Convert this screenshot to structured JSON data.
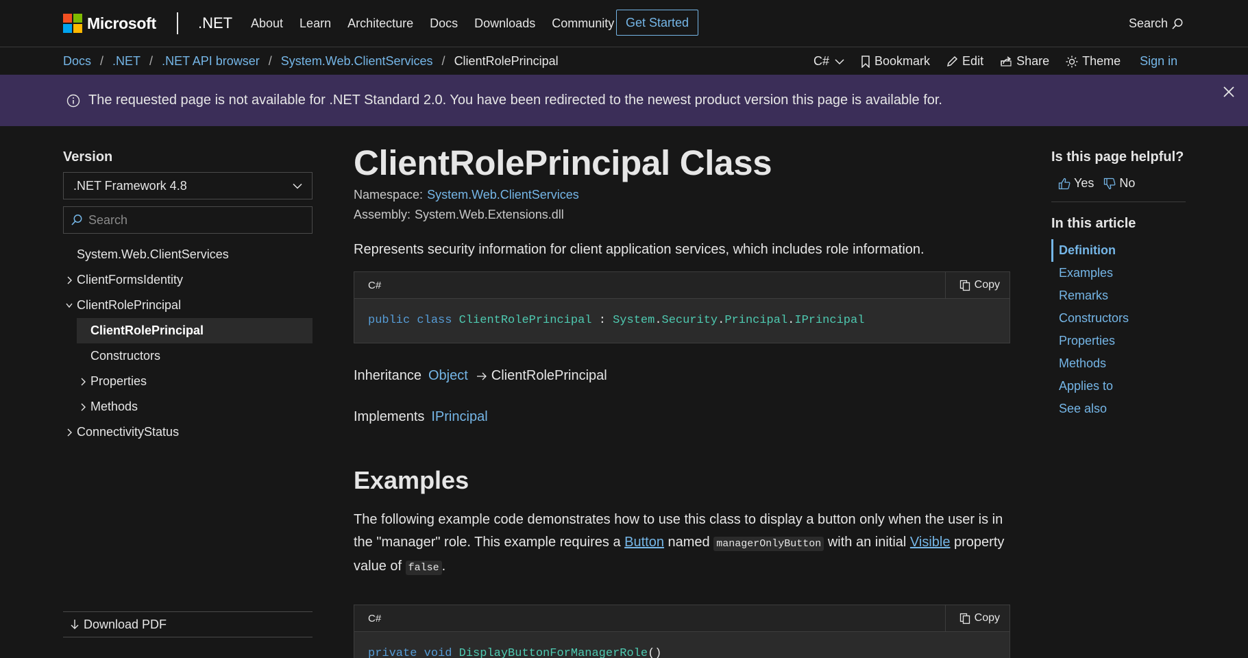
{
  "header": {
    "brand": "Microsoft",
    "product": ".NET",
    "nav": [
      "About",
      "Learn",
      "Architecture",
      "Docs",
      "Downloads",
      "Community"
    ],
    "cta": "Get Started",
    "search_label": "Search"
  },
  "breadcrumb": [
    ".NET",
    ".NET API browser",
    "System.Web.ClientServices"
  ],
  "breadcrumb_first": "Docs",
  "breadcrumb_current": "ClientRolePrincipal",
  "actions": {
    "language": "C#",
    "bookmark": "Bookmark",
    "edit": "Edit",
    "share": "Share",
    "theme": "Theme",
    "sign_in": "Sign in"
  },
  "banner": {
    "message": "The requested page is not available for .NET Standard 2.0. You have been redirected to the newest product version this page is available for."
  },
  "sidebar": {
    "version_label": "Version",
    "version_value": ".NET Framework 4.8",
    "search_placeholder": "Search",
    "toc": [
      {
        "label": "System.Web.ClientServices",
        "indent": 1,
        "chevron": "none"
      },
      {
        "label": "ClientFormsIdentity",
        "indent": 1,
        "chevron": "right"
      },
      {
        "label": "ClientRolePrincipal",
        "indent": 1,
        "chevron": "down"
      },
      {
        "label": "ClientRolePrincipal",
        "indent": 2,
        "chevron": "none",
        "selected": true
      },
      {
        "label": "Constructors",
        "indent": 2,
        "chevron": "none"
      },
      {
        "label": "Properties",
        "indent": 2,
        "chevron": "right"
      },
      {
        "label": "Methods",
        "indent": 2,
        "chevron": "right"
      },
      {
        "label": "ConnectivityStatus",
        "indent": 1,
        "chevron": "right"
      }
    ],
    "download_pdf": "Download PDF"
  },
  "main": {
    "title": "ClientRolePrincipal Class",
    "namespace_label": "Namespace:",
    "namespace_value": "System.Web.ClientServices",
    "assembly_label": "Assembly:",
    "assembly_value": "System.Web.Extensions.dll",
    "summary": "Represents security information for client application services, which includes role information.",
    "code1": {
      "lang": "C#",
      "copy": "Copy",
      "kw1": "public",
      "kw2": "class",
      "type": "ClientRolePrincipal",
      "colon": ":",
      "ns1": "System",
      "ns2": "Security",
      "ns3": "Principal",
      "iface": "IPrincipal",
      "dot": "."
    },
    "inheritance_label": "Inheritance",
    "inheritance_base": "Object",
    "inheritance_self": "ClientRolePrincipal",
    "implements_label": "Implements",
    "implements_value": "IPrincipal",
    "examples_heading": "Examples",
    "examples_p": {
      "t1": "The following example code demonstrates how to use this class to display a button only when the user is in the \"manager\" role. This example requires a ",
      "l1": "Button",
      "t2": " named ",
      "c1": "managerOnlyButton",
      "t3": " with an initial ",
      "l2": "Visible",
      "t4": " property value of ",
      "c2": "false",
      "t5": "."
    },
    "code2": {
      "lang": "C#",
      "copy": "Copy",
      "kw1": "private",
      "kw2": "void",
      "method": "DisplayButtonForManagerRole",
      "parens": "()"
    }
  },
  "right": {
    "helpful_title": "Is this page helpful?",
    "yes": "Yes",
    "no": "No",
    "toc_title": "In this article",
    "toc": [
      "Definition",
      "Examples",
      "Remarks",
      "Constructors",
      "Properties",
      "Methods",
      "Applies to",
      "See also"
    ]
  },
  "colors": {
    "background": "#171717",
    "link": "#75b6e7",
    "banner": "#3b2e58",
    "ms_red": "#f25022",
    "ms_green": "#7fba00",
    "ms_blue": "#00a4ef",
    "ms_yellow": "#ffb900"
  }
}
